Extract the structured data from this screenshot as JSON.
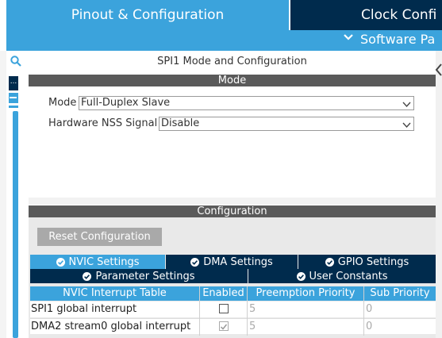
{
  "tabs": {
    "pinout": "Pinout & Configuration",
    "clock": "Clock Confi"
  },
  "subbar": {
    "software_packs": "Software Pa"
  },
  "left": {
    "dots": "..."
  },
  "mode": {
    "title": "SPI1 Mode and Configuration",
    "header": "Mode",
    "mode_label": "Mode",
    "mode_value": "Full-Duplex Slave",
    "nss_label": "Hardware NSS Signal",
    "nss_value": "Disable"
  },
  "configuration": {
    "header": "Configuration",
    "reset_button": "Reset Configuration",
    "tabs": {
      "nvic": "NVIC Settings",
      "dma": "DMA Settings",
      "gpio": "GPIO Settings",
      "parameter": "Parameter Settings",
      "user_constants": "User Constants"
    },
    "table": {
      "columns": [
        "NVIC Interrupt Table",
        "Enabled",
        "Preemption Priority",
        "Sub Priority"
      ],
      "rows": [
        {
          "name": "SPI1 global interrupt",
          "enabled": false,
          "preemption": "5",
          "sub": "0"
        },
        {
          "name": "DMA2 stream0 global interrupt",
          "enabled": true,
          "preemption": "5",
          "sub": "0"
        }
      ]
    }
  },
  "colors": {
    "accent": "#3ba3dc",
    "dark": "#002b4d",
    "header_gray": "#5a5a5a",
    "button_gray": "#a9a9a9"
  }
}
